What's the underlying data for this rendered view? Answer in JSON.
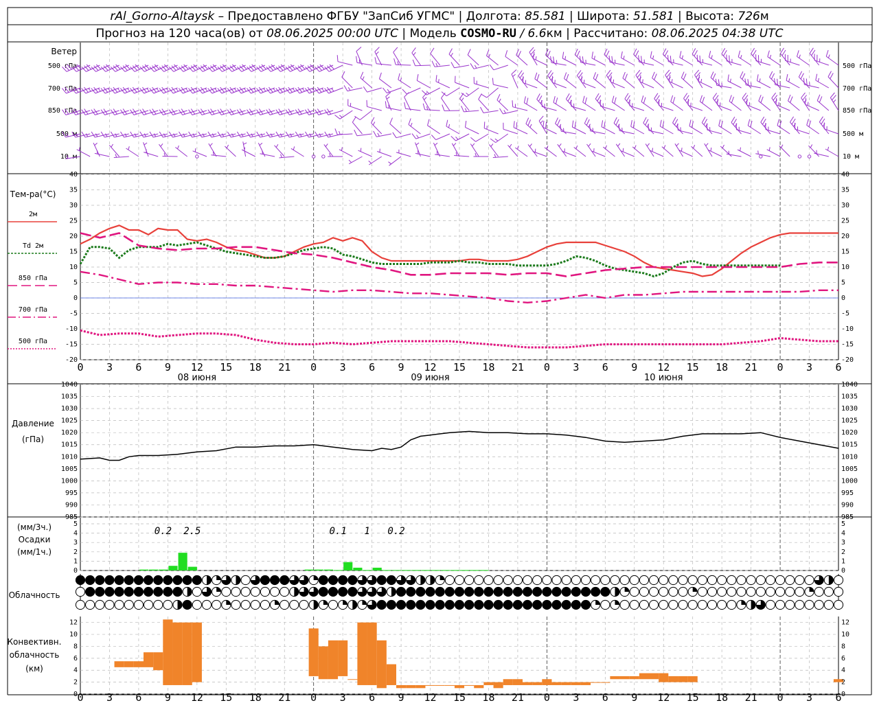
{
  "header": {
    "station": "rAl_Gorno-Altaysk",
    "provider": "– Предоставлено ФГБУ \"ЗапСиб УГМС\"",
    "lon_label": "Долгота:",
    "lon_value": "85.581",
    "lat_label": "Широта:",
    "lat_value": "51.581",
    "alt_label": "Высота:",
    "alt_value": "726",
    "alt_unit": "м",
    "forecast_prefix": "Прогноз на 120 часа(ов) от",
    "forecast_time": "08.06.2025 00:00 UTC",
    "model_label": "Модель",
    "model_name": "COSMO-RU",
    "model_res": "/ 6.6",
    "model_res_unit": "км",
    "calc_label": "Рассчитано:",
    "calc_time": "08.06.2025 04:38 UTC"
  },
  "wind": {
    "title": "Ветер",
    "levels": [
      "500 гПа",
      "700 гПа",
      "850 гПа",
      "500 м",
      "10  м"
    ],
    "color": "#9933cc"
  },
  "temperature": {
    "title": "Тем-ра(°C)",
    "legend": [
      {
        "label": "2м",
        "color": "#e8403a"
      },
      {
        "label": "Td  2м",
        "color": "#1a7a1a"
      },
      {
        "label": "850 гПа",
        "color": "#e0157f"
      },
      {
        "label": "700 гПа",
        "color": "#e0157f"
      },
      {
        "label": "500 гПа",
        "color": "#e0157f"
      }
    ],
    "yticks": [
      "40",
      "35",
      "30",
      "25",
      "20",
      "15",
      "10",
      "5",
      "0",
      "-5",
      "-10",
      "-15",
      "-20"
    ]
  },
  "pressure": {
    "title": "Давление",
    "unit": "(гПа)",
    "yticks": [
      "1040",
      "1035",
      "1030",
      "1025",
      "1020",
      "1015",
      "1010",
      "1005",
      "1000",
      "995",
      "990",
      "985"
    ]
  },
  "precip": {
    "unit3": "(мм/3ч.)",
    "title": "Осадки",
    "unit1": "(мм/1ч.)",
    "yticks": [
      "5",
      "4",
      "3",
      "2",
      "1",
      "0"
    ],
    "totals": [
      {
        "hour": 9,
        "text": "0.2"
      },
      {
        "hour": 12,
        "text": "2.5"
      },
      {
        "hour": 27,
        "text": "0.1"
      },
      {
        "hour": 30,
        "text": "1"
      },
      {
        "hour": 33,
        "text": "0.2"
      }
    ]
  },
  "cloud": {
    "title": "Облачность"
  },
  "convective": {
    "title1": "Конвективн.",
    "title2": "облачность",
    "unit": "(км)",
    "yticks": [
      "12",
      "10",
      "8",
      "6",
      "4",
      "2",
      "0"
    ],
    "color": "#f0842a"
  },
  "x_axis": {
    "ticks": [
      "0",
      "3",
      "6",
      "9",
      "12",
      "15",
      "18",
      "21",
      "0",
      "3",
      "6",
      "9",
      "12",
      "15",
      "18",
      "21",
      "0",
      "3",
      "6",
      "9",
      "12",
      "15",
      "18",
      "21",
      "0",
      "3",
      "6"
    ],
    "dates": [
      {
        "hour": 12,
        "text": "08 июня"
      },
      {
        "hour": 36,
        "text": "09 июня"
      },
      {
        "hour": 60,
        "text": "10 июня"
      }
    ]
  },
  "chart_data": [
    {
      "type": "line",
      "title": "Тем-ра(°C)",
      "x_unit": "hours from 08.06.2025 00:00 UTC",
      "ylim": [
        -20,
        40
      ],
      "series": [
        {
          "name": "2м",
          "x": [
            0,
            1,
            2,
            3,
            4,
            5,
            6,
            7,
            8,
            9,
            10,
            11,
            12,
            13,
            14,
            15,
            16,
            17,
            18,
            19,
            20,
            21,
            22,
            23,
            24,
            25,
            26,
            27,
            28,
            29,
            30,
            31,
            32,
            33,
            34,
            35,
            36,
            37,
            38,
            39,
            40,
            41,
            42,
            43,
            44,
            45,
            46,
            47,
            48,
            49,
            50,
            51,
            52,
            53,
            54,
            55,
            56,
            57,
            58,
            59,
            60,
            61,
            62,
            63,
            64,
            65,
            66,
            67,
            68,
            69,
            70,
            71,
            72,
            73,
            74,
            75,
            76,
            77,
            78
          ],
          "values": [
            17.5,
            19,
            21,
            22.5,
            23.5,
            22,
            22,
            20.5,
            22.5,
            22,
            22,
            19,
            18.5,
            19,
            18,
            16.5,
            15.5,
            15,
            14,
            13,
            13,
            13.5,
            15,
            16.5,
            17.5,
            18,
            19.5,
            18.5,
            19.5,
            18.5,
            15,
            13,
            12,
            12,
            12,
            12,
            12,
            12,
            12,
            12,
            12.5,
            12.5,
            12,
            12,
            12,
            12.5,
            13.5,
            15,
            16.5,
            17.5,
            18,
            18,
            18,
            18,
            17,
            16,
            15,
            13.5,
            11.5,
            10,
            9.5,
            9,
            8.5,
            8,
            7,
            7.5,
            9.5,
            12,
            14.5,
            16.5,
            18,
            19.5,
            20.5,
            21,
            21,
            21,
            21,
            21,
            21
          ]
        },
        {
          "name": "Td  2м",
          "x": [
            0,
            1,
            2,
            3,
            4,
            5,
            6,
            7,
            8,
            9,
            10,
            11,
            12,
            13,
            14,
            15,
            16,
            17,
            18,
            19,
            20,
            21,
            22,
            23,
            24,
            25,
            26,
            27,
            28,
            29,
            30,
            31,
            32,
            33,
            34,
            35,
            36,
            37,
            38,
            39,
            40,
            41,
            42,
            43,
            44,
            45,
            46,
            47,
            48,
            49,
            50,
            51,
            52,
            53,
            54,
            55,
            56,
            57,
            58,
            59,
            60,
            61,
            62,
            63,
            64,
            65,
            66,
            67,
            68,
            69,
            70,
            71,
            72
          ],
          "values": [
            11,
            16.5,
            16.5,
            16,
            13,
            15.5,
            16.5,
            16.5,
            16.5,
            17.5,
            17,
            17.5,
            18,
            17,
            16,
            15,
            14.5,
            14,
            13.5,
            13,
            13,
            13.5,
            14.5,
            15.5,
            16,
            16.5,
            16,
            14,
            13.5,
            12.5,
            11.5,
            11,
            11,
            11,
            11,
            11,
            11.5,
            11.5,
            11.5,
            12,
            11.5,
            11.5,
            11,
            11,
            11,
            10.5,
            10.5,
            10.5,
            10.5,
            11,
            12,
            13.5,
            13,
            12,
            10.5,
            9.5,
            9,
            8.5,
            8,
            7,
            8,
            10,
            11.5,
            12,
            11,
            10.5,
            10.5,
            10.5,
            10.5,
            10.5,
            10.5,
            10.5,
            10.5
          ]
        },
        {
          "name": "850 гПа",
          "x": [
            0,
            2,
            4,
            6,
            8,
            10,
            12,
            14,
            16,
            18,
            20,
            22,
            24,
            26,
            28,
            30,
            32,
            34,
            36,
            38,
            40,
            42,
            44,
            46,
            48,
            50,
            52,
            54,
            56,
            58,
            60,
            62,
            64,
            66,
            68,
            70,
            72,
            74,
            76,
            78
          ],
          "values": [
            21,
            19.5,
            21,
            17,
            16,
            15.5,
            16,
            16,
            16.5,
            16.5,
            15.5,
            14.5,
            14,
            13,
            11.5,
            10,
            9,
            7.5,
            7.5,
            8,
            8,
            8,
            7.5,
            8,
            8,
            7,
            8,
            9,
            9.5,
            10,
            10,
            10,
            10,
            10,
            10,
            10,
            10,
            11,
            11.5,
            11.5
          ]
        },
        {
          "name": "700 гПа",
          "x": [
            0,
            2,
            4,
            6,
            8,
            10,
            12,
            14,
            16,
            18,
            20,
            22,
            24,
            26,
            28,
            30,
            32,
            34,
            36,
            38,
            40,
            42,
            44,
            46,
            48,
            50,
            52,
            54,
            56,
            58,
            60,
            62,
            64,
            66,
            68,
            70,
            72,
            74,
            76,
            78
          ],
          "values": [
            8.5,
            7.5,
            6,
            4.5,
            5,
            5,
            4.5,
            4.5,
            4,
            4,
            3.5,
            3,
            2.5,
            2,
            2.5,
            2.5,
            2,
            1.5,
            1.5,
            1,
            0.5,
            0,
            -1,
            -1.5,
            -1,
            0,
            1,
            0,
            1,
            1,
            1.5,
            2,
            2,
            2,
            2,
            2,
            2,
            2,
            2.5,
            2.5
          ]
        },
        {
          "name": "500 гПа",
          "x": [
            0,
            2,
            4,
            6,
            8,
            10,
            12,
            14,
            16,
            18,
            20,
            22,
            24,
            26,
            28,
            30,
            32,
            34,
            36,
            38,
            40,
            42,
            44,
            46,
            48,
            50,
            52,
            54,
            56,
            58,
            60,
            62,
            64,
            66,
            68,
            70,
            72,
            74,
            76,
            78
          ],
          "values": [
            -10.5,
            -12,
            -11.5,
            -11.5,
            -12.5,
            -12,
            -11.5,
            -11.5,
            -12,
            -13.5,
            -14.5,
            -15,
            -15,
            -14.5,
            -15,
            -14.5,
            -14,
            -14,
            -14,
            -14,
            -14.5,
            -15,
            -15.5,
            -16,
            -16,
            -16,
            -15.5,
            -15,
            -15,
            -15,
            -15,
            -15,
            -15,
            -15,
            -14.5,
            -14,
            -13,
            -13.5,
            -14,
            -14
          ]
        }
      ]
    },
    {
      "type": "line",
      "title": "Давление",
      "ylabel": "(гПа)",
      "ylim": [
        985,
        1040
      ],
      "x": [
        0,
        2,
        3,
        4,
        5,
        6,
        8,
        10,
        12,
        14,
        16,
        18,
        20,
        22,
        24,
        26,
        28,
        30,
        31,
        32,
        33,
        34,
        35,
        36,
        38,
        40,
        42,
        44,
        46,
        48,
        50,
        52,
        54,
        56,
        58,
        60,
        62,
        64,
        66,
        68,
        70,
        72,
        74,
        76,
        78
      ],
      "values": [
        1009,
        1009.5,
        1008.5,
        1008.5,
        1010,
        1010.5,
        1010.5,
        1011,
        1012,
        1012.5,
        1014,
        1014,
        1014.5,
        1014.5,
        1015,
        1014,
        1013,
        1012.5,
        1013.5,
        1013,
        1014,
        1017,
        1018.5,
        1019,
        1020,
        1020.5,
        1020,
        1020,
        1019.5,
        1019.5,
        1019,
        1018,
        1016.5,
        1016,
        1016.5,
        1017,
        1018.5,
        1019.5,
        1019.5,
        1019.5,
        1020,
        1018,
        1016.5,
        1015,
        1013.5
      ]
    },
    {
      "type": "bar",
      "title": "Осадки",
      "ylabel": "(мм/1ч.)",
      "ylim": [
        0,
        5
      ],
      "x": [
        7,
        8,
        9,
        10,
        11,
        12,
        24,
        25,
        26,
        27,
        28,
        29,
        30,
        31,
        32,
        33,
        34,
        35,
        36,
        37,
        38,
        39,
        40,
        41,
        42
      ],
      "values": [
        0.1,
        0.1,
        0.1,
        0.5,
        1.9,
        0.4,
        0.1,
        0.1,
        0.1,
        0.05,
        0.9,
        0.3,
        0.05,
        0.3,
        0.05,
        0.05,
        0.05,
        0.05,
        0.05,
        0.05,
        0.05,
        0.05,
        0.05,
        0.05,
        0.05
      ]
    },
    {
      "type": "bar",
      "title": "Конвективн. облачность",
      "ylabel": "(км)",
      "ylim": [
        0,
        13
      ],
      "x": [
        4,
        5,
        6,
        7,
        8,
        9,
        10,
        11,
        12,
        24,
        25,
        26,
        27,
        28,
        29,
        30,
        31,
        32,
        33,
        34,
        35,
        36,
        37,
        38,
        39,
        40,
        41,
        42,
        43,
        44,
        45,
        46,
        47,
        48,
        49,
        50,
        51,
        52,
        53,
        54,
        55,
        56,
        57,
        58,
        59,
        60,
        61,
        62,
        63,
        78
      ],
      "base": [
        4.5,
        4.5,
        4.5,
        4.5,
        4,
        1.5,
        1.5,
        1.5,
        2,
        3,
        2.5,
        2.5,
        3,
        2.5,
        1.5,
        1.5,
        1,
        1.5,
        1,
        1,
        1,
        1.5,
        1.5,
        1.5,
        1,
        1.5,
        1,
        1.5,
        1,
        1.5,
        1.5,
        1.5,
        1.5,
        1.5,
        1.5,
        1.5,
        1.5,
        1.5,
        2,
        2,
        2.5,
        2.5,
        2.5,
        2.5,
        2.5,
        2,
        2,
        2,
        2,
        2
      ],
      "top": [
        5.5,
        5.5,
        5.5,
        7,
        7,
        12.5,
        12,
        12,
        12,
        11,
        8,
        9,
        9,
        2.5,
        12,
        12,
        9,
        5,
        1.5,
        1.5,
        1.5,
        1.5,
        1.5,
        1.5,
        1.5,
        1.5,
        1.5,
        2,
        2,
        2.5,
        2.5,
        2,
        2,
        2.5,
        2,
        2,
        2,
        2,
        2,
        2,
        3,
        3,
        3,
        3.5,
        3.5,
        3.5,
        3,
        3,
        3,
        2.5
      ]
    }
  ]
}
